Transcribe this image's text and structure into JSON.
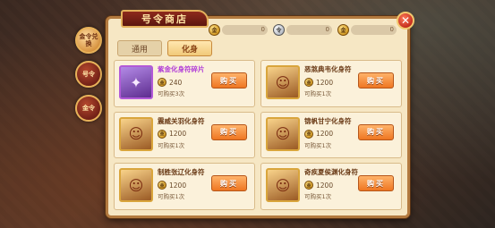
{
  "shop": {
    "title": "号令商店",
    "close_icon": "close-icon",
    "currencies": [
      {
        "icon": "gold-coin-icon",
        "value": "0"
      },
      {
        "icon": "silver-coin-icon",
        "value": "0"
      },
      {
        "icon": "gold-coin-icon",
        "value": "0"
      }
    ],
    "tabs": [
      {
        "label": "通用",
        "active": false
      },
      {
        "label": "化身",
        "active": true
      }
    ],
    "side_tabs": [
      {
        "label": "金令兑换",
        "active": true
      },
      {
        "label": "号令",
        "active": false
      },
      {
        "label": "金令",
        "active": false
      }
    ],
    "items": [
      {
        "name": "紫金化身符碎片",
        "price": "240",
        "limit": "可购买3次",
        "rarity": "purple",
        "buy_label": "购买"
      },
      {
        "name": "恶煞典韦化身符",
        "price": "1200",
        "limit": "可购买1次",
        "rarity": "normal",
        "buy_label": "购买"
      },
      {
        "name": "震威关羽化身符",
        "price": "1200",
        "limit": "可购买1次",
        "rarity": "normal",
        "buy_label": "购买"
      },
      {
        "name": "锦帆甘宁化身符",
        "price": "1200",
        "limit": "可购买1次",
        "rarity": "normal",
        "buy_label": "购买"
      },
      {
        "name": "制胜张辽化身符",
        "price": "1200",
        "limit": "可购买1次",
        "rarity": "normal",
        "buy_label": "购买"
      },
      {
        "name": "奇疾夏侯渊化身符",
        "price": "1200",
        "limit": "可购买1次",
        "rarity": "normal",
        "buy_label": "购买"
      }
    ]
  },
  "colors": {
    "panel_bg": "#f6e7c4",
    "buy_button": "#ef7622",
    "purple_rarity": "#b03ad8"
  }
}
